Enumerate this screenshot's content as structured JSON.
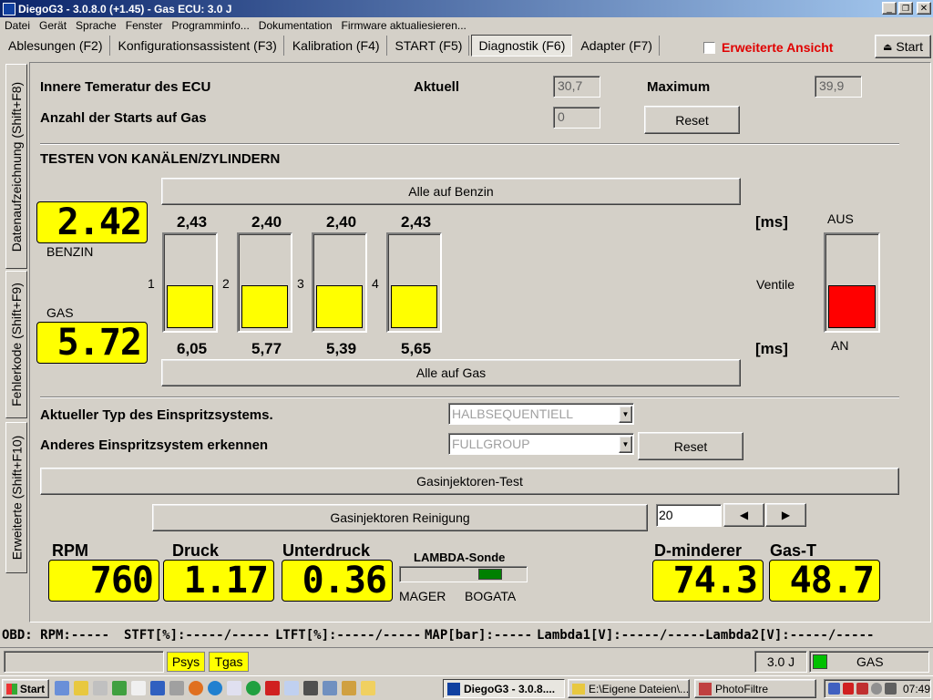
{
  "window": {
    "title": "DiegoG3 - 3.0.8.0 (+1.45) - Gas ECU: 3.0 J"
  },
  "menu": [
    "Datei",
    "Gerät",
    "Sprache",
    "Fenster",
    "Programminfo...",
    "Dokumentation",
    "Firmware aktualiesieren..."
  ],
  "tabs": [
    {
      "label": "Ablesungen (F2)"
    },
    {
      "label": "Konfigurationsassistent (F3)"
    },
    {
      "label": "Kalibration (F4)"
    },
    {
      "label": "START (F5)"
    },
    {
      "label": "Diagnostik (F6)",
      "active": true
    },
    {
      "label": "Adapter (F7)"
    }
  ],
  "extended_view_label": "Erweiterte Ansicht",
  "start_button": "Start",
  "side_tabs": [
    "Datenaufzeichnung (Shift+F8)",
    "Fehlerkode (Shift+F9)",
    "Erweiterte (Shift+F10)"
  ],
  "ecu": {
    "temp_label": "Innere Temeratur des ECU",
    "aktuell_label": "Aktuell",
    "aktuell_value": "30,7",
    "maximum_label": "Maximum",
    "maximum_value": "39,9",
    "starts_label": "Anzahl der Starts auf Gas",
    "starts_value": "0",
    "reset_label": "Reset"
  },
  "channels": {
    "title": "TESTEN VON KANÄLEN/ZYLINDERN",
    "alle_benzin": "Alle auf Benzin",
    "alle_gas": "Alle auf Gas",
    "benzin_display": "2.42",
    "benzin_label": "BENZIN",
    "gas_label": "GAS",
    "gas_display": "5.72",
    "unit": "[ms]",
    "ventile_label": "Ventile",
    "aus_label": "AUS",
    "an_label": "AN",
    "cylinders": [
      {
        "num": "1",
        "benzin": "2,43",
        "gas": "6,05",
        "fill": 0.44
      },
      {
        "num": "2",
        "benzin": "2,40",
        "gas": "5,77",
        "fill": 0.44
      },
      {
        "num": "3",
        "benzin": "2,40",
        "gas": "5,39",
        "fill": 0.44
      },
      {
        "num": "4",
        "benzin": "2,43",
        "gas": "5,65",
        "fill": 0.44
      }
    ],
    "ventile_fill": 0.44,
    "ventile_color": "#ff0000"
  },
  "injection": {
    "type_label": "Aktueller Typ des Einspritzsystems.",
    "type_value": "HALBSEQUENTIELL",
    "detect_label": "Anderes Einspritzsystem erkennen",
    "detect_value": "FULLGROUP",
    "reset_label": "Reset",
    "test_label": "Gasinjektoren-Test",
    "clean_label": "Gasinjektoren Reinigung",
    "clean_value": "20"
  },
  "gauges": {
    "rpm_label": "RPM",
    "rpm": "760",
    "druck_label": "Druck",
    "druck": "1.17",
    "unterdruck_label": "Unterdruck",
    "unterdruck": "0.36",
    "lambda_label": "LAMBDA-Sonde",
    "mager": "MAGER",
    "bogata": "BOGATA",
    "lambda_color": "#008000",
    "dminderer_label": "D-minderer",
    "dminderer": "74.3",
    "gast_label": "Gas-T",
    "gast": "48.7"
  },
  "obd": {
    "rpm": "OBD: RPM:-----",
    "stft": "STFT[%]:-----/-----",
    "ltft": "LTFT[%]:-----/-----",
    "map": "MAP[bar]:-----",
    "lambda1": "Lambda1[V]:-----/-----",
    "lambda2": "Lambda2[V]:-----/-----"
  },
  "status": {
    "psys": "Psys",
    "tgas": "Tgas",
    "version": "3.0 J",
    "mode": "GAS",
    "mode_color": "#00c000"
  },
  "taskbar": {
    "start": "Start",
    "tasks": [
      "DiegoG3 - 3.0.8....",
      "E:\\Eigene Dateien\\...",
      "PhotoFiltre"
    ],
    "clock": "07:49"
  }
}
